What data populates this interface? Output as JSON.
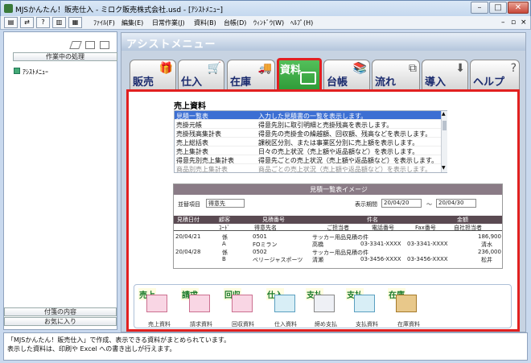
{
  "window": {
    "title": "MJSかんたん！販売仕入 - ミロク販売株式会社.usd - [ｱｼｽﾄﾒﾆｭｰ]"
  },
  "menu": [
    "ﾌｧｲﾙ(F)",
    "編集(E)",
    "日常作業(J)",
    "資料(B)",
    "台帳(D)",
    "ｳｨﾝﾄﾞｳ(W)",
    "ﾍﾙﾌﾟ(H)"
  ],
  "left": {
    "heading": "作業中の処理",
    "item": "ｱｼｽﾄﾒﾆｭｰ",
    "bottom": [
      "付箋の内容",
      "お気に入り"
    ]
  },
  "banner": "アシストメニュー",
  "tabs": [
    {
      "label": "販売",
      "icon": "gift-icon"
    },
    {
      "label": "仕入",
      "icon": "cart-icon"
    },
    {
      "label": "在庫",
      "icon": "truck-icon"
    },
    {
      "label": "資料",
      "icon": "book-icon"
    },
    {
      "label": "台帳",
      "icon": "ledger-icon"
    },
    {
      "label": "流れ",
      "icon": "flow-icon"
    },
    {
      "label": "導入",
      "icon": "install-icon"
    },
    {
      "label": "ヘルプ",
      "icon": "help-icon"
    }
  ],
  "section_title": "売上資料",
  "reports": [
    {
      "name": "見積一覧表",
      "desc": "入力した見積書の一覧を表示します。"
    },
    {
      "name": "売掛元帳",
      "desc": "得意先別に取引明細と売掛残高を表示します。"
    },
    {
      "name": "売掛残高集計表",
      "desc": "得意先の売掛金の繰越額、回収額、残高などを表示します。"
    },
    {
      "name": "売上総括表",
      "desc": "課税区分別、または事業区分別に売上額を表示します。"
    },
    {
      "name": "売上集計表",
      "desc": "日々の売上状況（売上額や返品額など）を表示します。"
    },
    {
      "name": "得意先別売上集計表",
      "desc": "得意先ごとの売上状況（売上額や返品額など）を表示します。"
    },
    {
      "name": "商品別売上集計表",
      "desc": "商品ごとの売上状況（売上額や返品額など）を表示します。"
    }
  ],
  "preview": {
    "title": "見積一覧表イメージ",
    "sort_label": "並替項目",
    "sort_value": "得意先",
    "period_label": "表示期間",
    "from": "20/04/20",
    "to": "20/04/30",
    "sep": "～",
    "head1": [
      "見積日付",
      "顧客",
      "見積番号",
      "件名",
      "金額"
    ],
    "head2": [
      "ｺｰﾄﾞ",
      "得意先名",
      "ご担当者",
      "電話番号",
      "Fax番号",
      "自社担当者"
    ],
    "rows": [
      [
        "20/04/21",
        "係",
        "0501",
        "サッカー用品見積の件",
        "",
        "",
        "186,900"
      ],
      [
        "",
        "A",
        "FOミラン",
        "高橋",
        "03-3341-XXXX",
        "03-3341-XXXX",
        "清水"
      ],
      [
        "20/04/28",
        "係",
        "0502",
        "サッカー用品見積の件",
        "",
        "",
        "236,000"
      ],
      [
        "",
        "B",
        "ベリージャスポーツ",
        "清瀬",
        "03-3456-XXXX",
        "03-3456-XXXX",
        "松井"
      ]
    ]
  },
  "flow": [
    {
      "label": "売上",
      "caption": "売上資料"
    },
    {
      "label": "請求",
      "caption": "請求資料"
    },
    {
      "label": "回収",
      "caption": "回収資料"
    },
    {
      "label": "仕入",
      "caption": "仕入資料"
    },
    {
      "label": "支払",
      "caption": "締め支払"
    },
    {
      "label": "支払",
      "caption": "支払資料"
    },
    {
      "label": "在庫",
      "caption": "在庫資料"
    }
  ],
  "status": [
    "「MJSかんたん！販売仕入」で作成、表示できる資料がまとめられています。",
    "表示した資料は、印刷や Excel への書き出しが行えます。"
  ]
}
